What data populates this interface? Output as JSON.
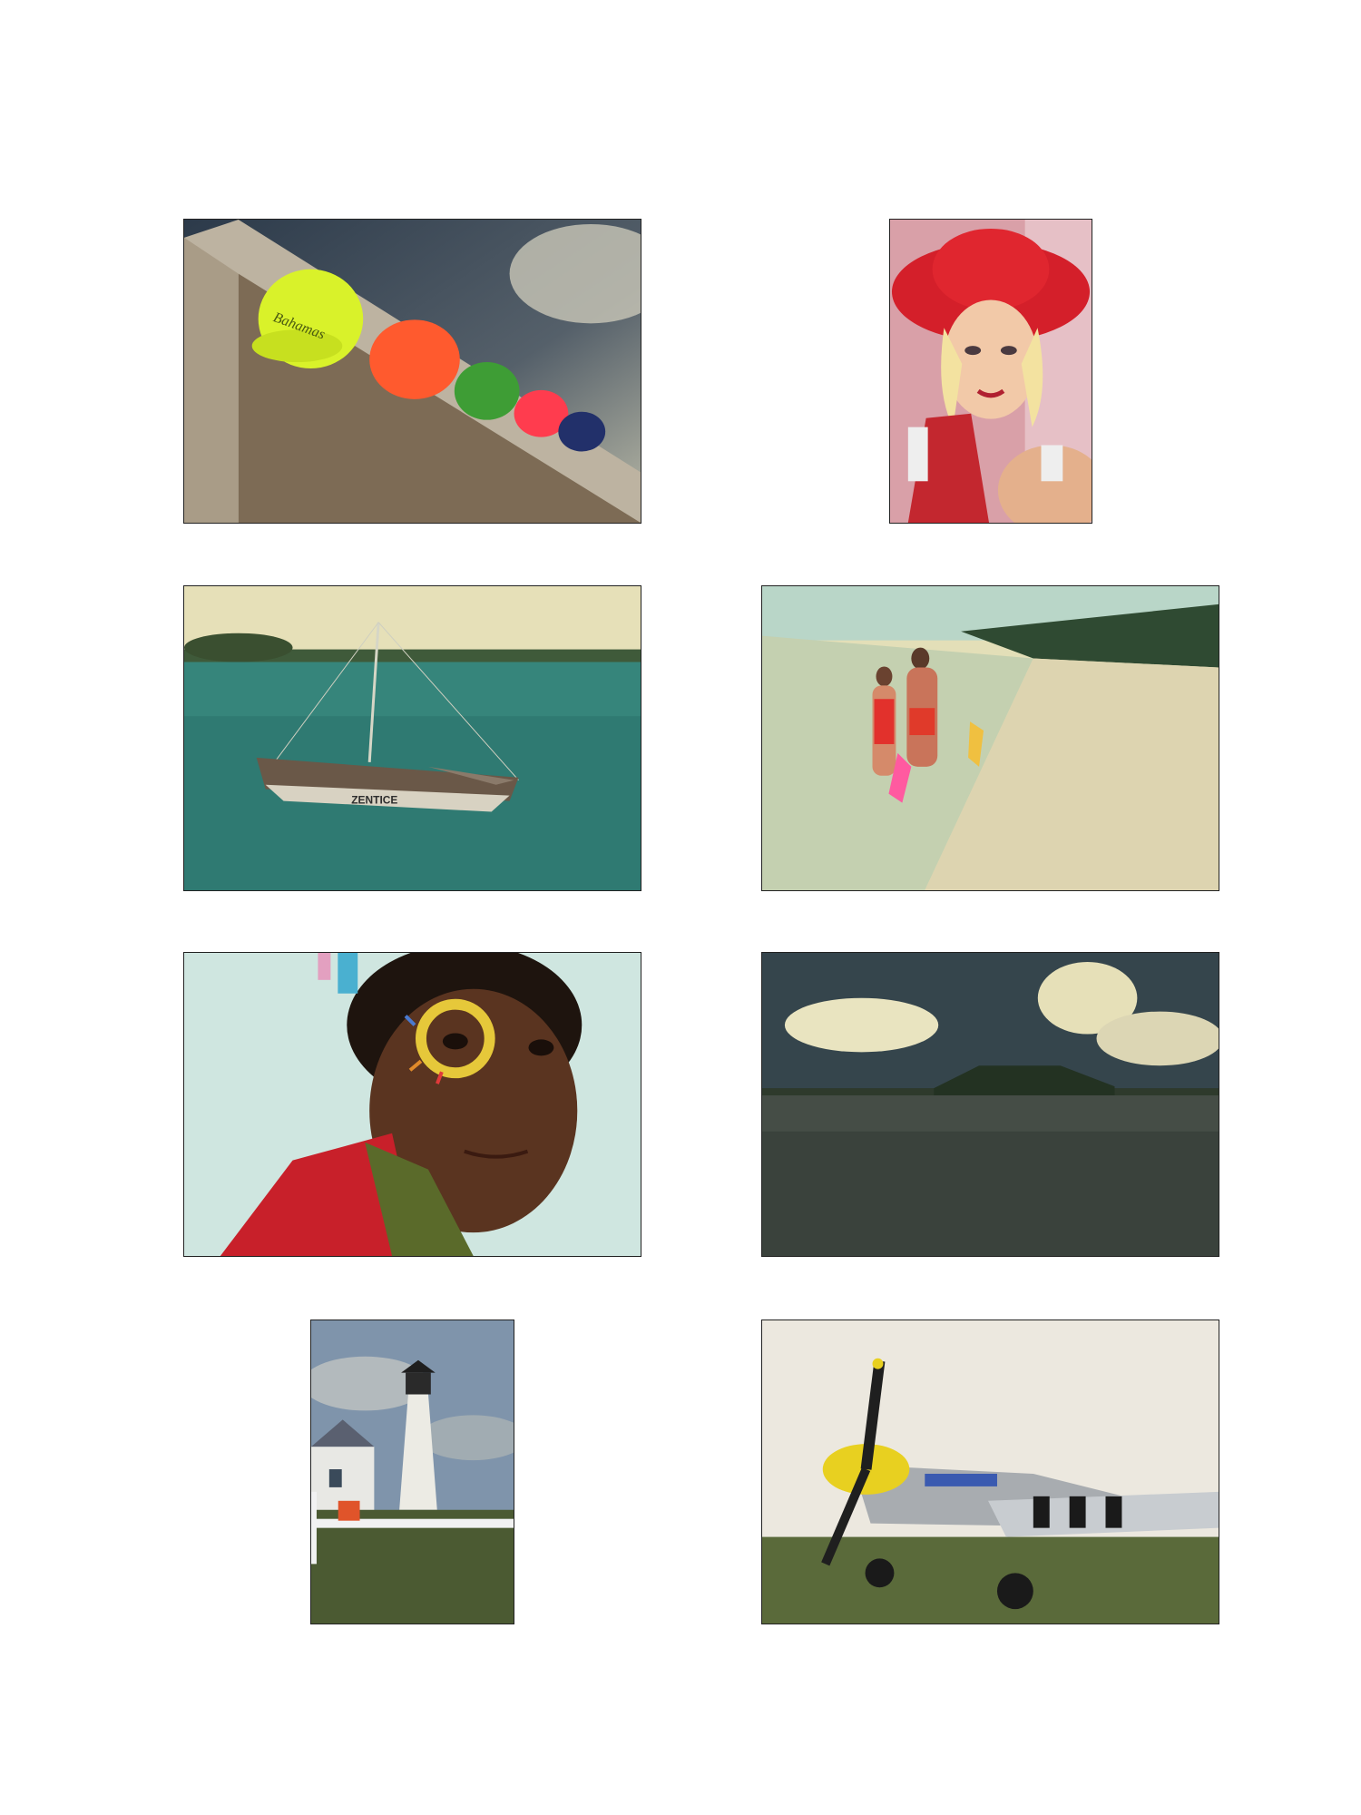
{
  "photos": [
    {
      "id": "p1",
      "subject": "colorful-caps-on-wall",
      "cap_text": "Bahamas"
    },
    {
      "id": "p2",
      "subject": "woman-in-red-hat"
    },
    {
      "id": "p3",
      "subject": "sailboat-in-harbor",
      "hull_text": "ZENTICE"
    },
    {
      "id": "p4",
      "subject": "couple-walking-on-beach"
    },
    {
      "id": "p5",
      "subject": "child-with-face-paint"
    },
    {
      "id": "p6",
      "subject": "palm-island-seascape"
    },
    {
      "id": "p7",
      "subject": "white-lighthouse"
    },
    {
      "id": "p8",
      "subject": "p51-mustang-airplane"
    }
  ],
  "colors": {
    "page_background": "#ffffff",
    "frame_border": "#222222"
  }
}
